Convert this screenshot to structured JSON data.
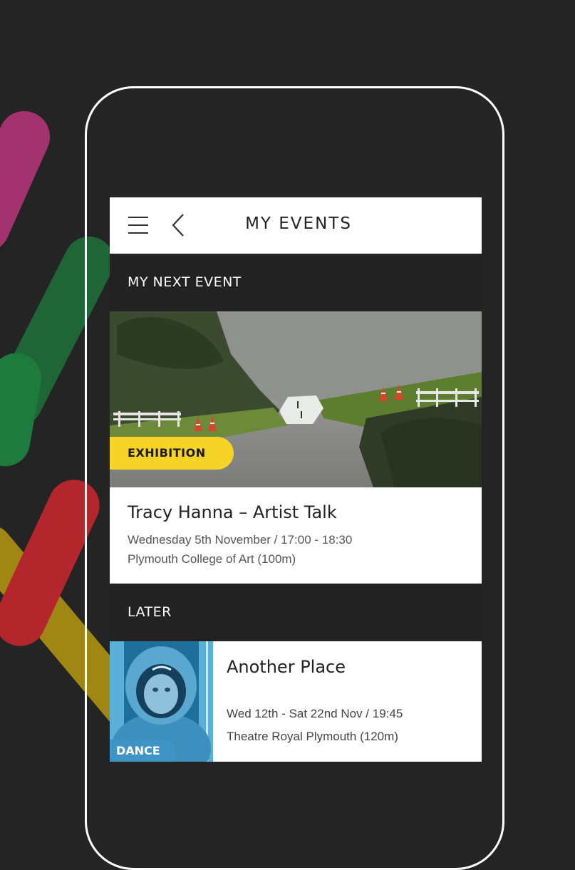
{
  "header": {
    "title": "MY EVENTS",
    "menu_icon": "hamburger-menu-icon",
    "back_icon": "chevron-left-icon"
  },
  "next_event_section": {
    "heading": "MY NEXT EVENT",
    "event": {
      "category": "EXHIBITION",
      "title": "Tracy Hanna – Artist Talk",
      "date_time": "Wednesday 5th November  /  17:00 - 18:30",
      "venue": "Plymouth College of Art (100m)"
    }
  },
  "later_section": {
    "heading": "LATER",
    "events": [
      {
        "category": "DANCE",
        "title": "Another Place",
        "date_time": "Wed 12th - Sat 22nd Nov  /  19:45",
        "venue": "Theatre Royal Plymouth (120m)"
      }
    ]
  },
  "colors": {
    "background": "#242424",
    "section_bar": "#222222",
    "exhibition_badge": "#f5d327",
    "dance_badge": "#3e94c5",
    "stripe_magenta": "#a3336f",
    "stripe_green": "#1f7a3c",
    "stripe_red": "#b3262b",
    "stripe_yellow": "#a68b16"
  }
}
